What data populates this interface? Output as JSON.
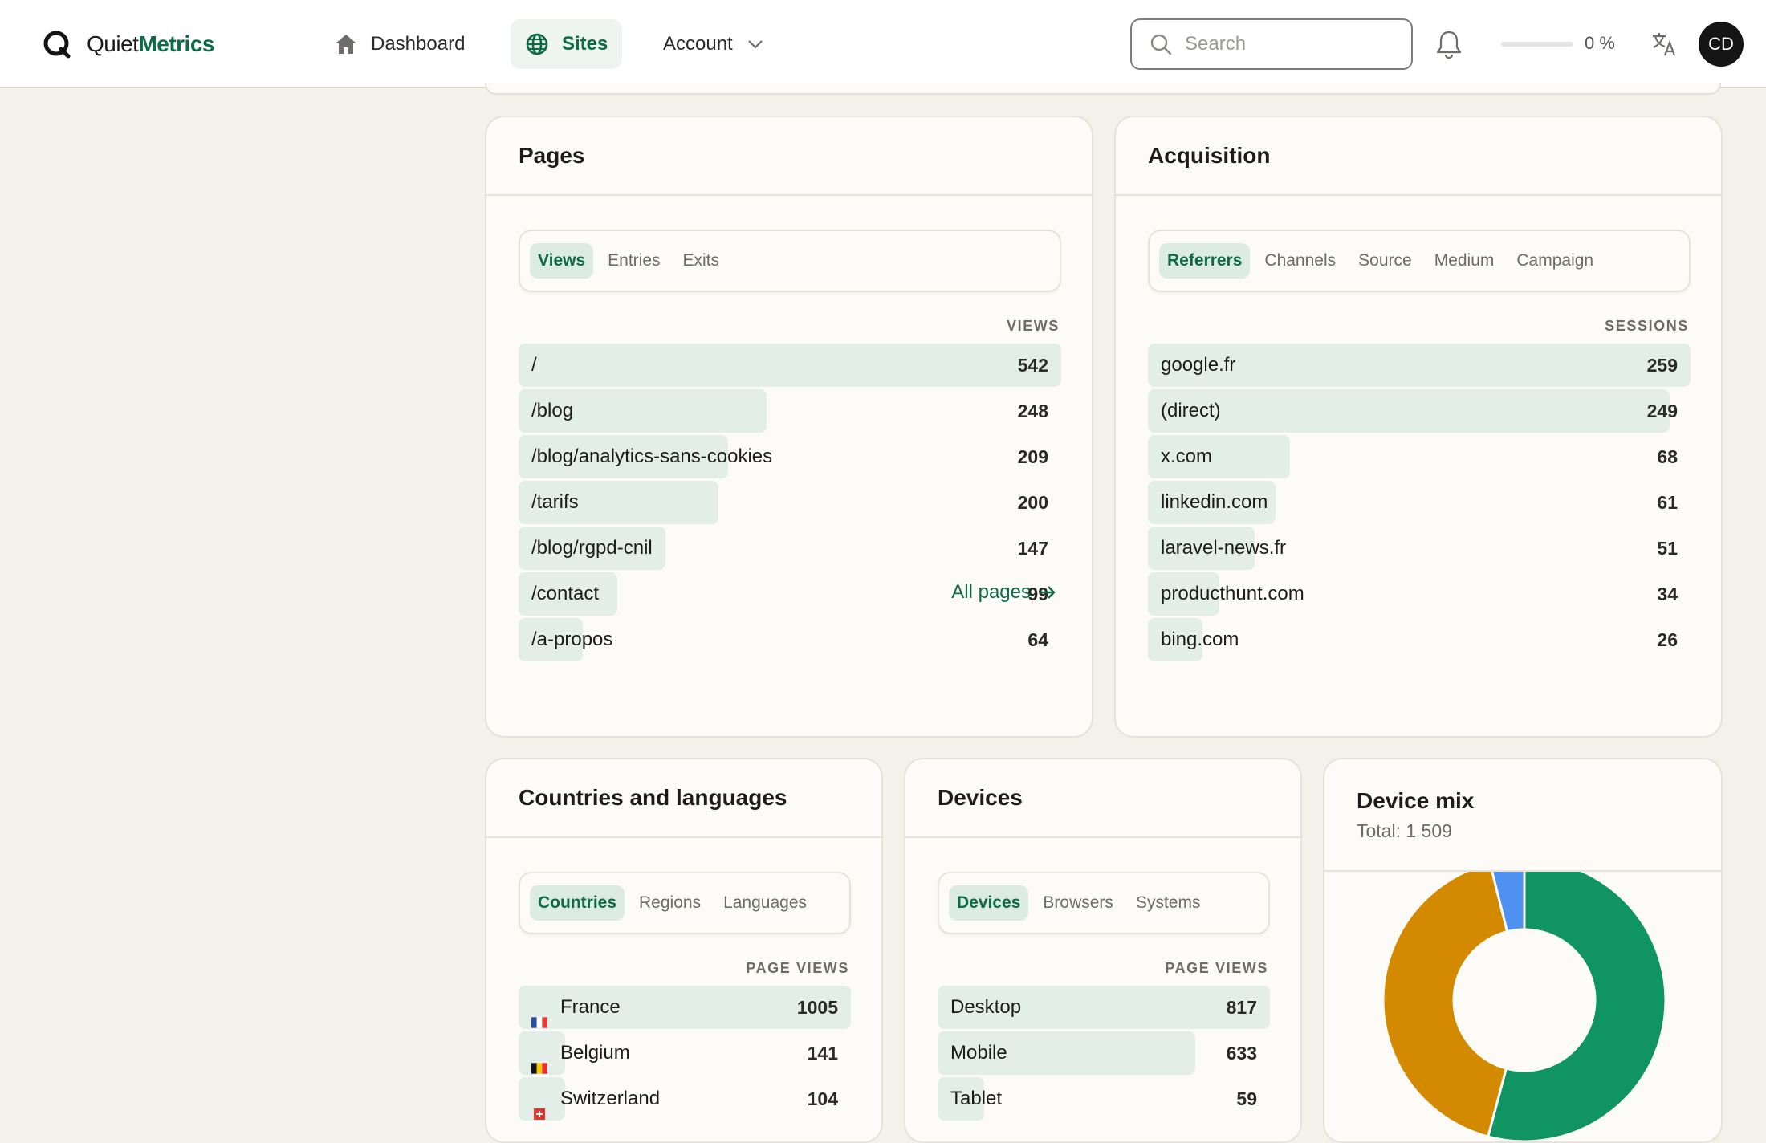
{
  "app": {
    "logo_prefix": "Quiet",
    "logo_suffix": "Metrics"
  },
  "nav": {
    "dashboard": "Dashboard",
    "sites": "Sites",
    "account": "Account"
  },
  "search": {
    "placeholder": "Search"
  },
  "progress": {
    "label": "0 %",
    "value": 0
  },
  "user": {
    "initials": "CD"
  },
  "colors": {
    "brand": "#0e6b47",
    "row_bar": "#e2eee7",
    "tab_active_bg": "#dcebe3",
    "desktop": "#119463",
    "mobile": "#d38a00",
    "tablet": "#4f91f0"
  },
  "pages": {
    "title": "Pages",
    "tabs": [
      "Views",
      "Entries",
      "Exits"
    ],
    "active_tab": 0,
    "column": "VIEWS",
    "max": 542,
    "rows": [
      {
        "label": "/",
        "value": 542
      },
      {
        "label": "/blog",
        "value": 248
      },
      {
        "label": "/blog/analytics-sans-cookies",
        "value": 209
      },
      {
        "label": "/tarifs",
        "value": 200
      },
      {
        "label": "/blog/rgpd-cnil",
        "value": 147
      },
      {
        "label": "/contact",
        "value": 99
      },
      {
        "label": "/a-propos",
        "value": 64
      }
    ],
    "all_link": "All pages"
  },
  "acquisition": {
    "title": "Acquisition",
    "tabs": [
      "Referrers",
      "Channels",
      "Source",
      "Medium",
      "Campaign"
    ],
    "active_tab": 0,
    "column": "SESSIONS",
    "max": 259,
    "rows": [
      {
        "label": "google.fr",
        "value": 259
      },
      {
        "label": "(direct)",
        "value": 249
      },
      {
        "label": "x.com",
        "value": 68
      },
      {
        "label": "linkedin.com",
        "value": 61
      },
      {
        "label": "laravel-news.fr",
        "value": 51
      },
      {
        "label": "producthunt.com",
        "value": 34
      },
      {
        "label": "bing.com",
        "value": 26
      }
    ]
  },
  "countries": {
    "title": "Countries and languages",
    "tabs": [
      "Countries",
      "Regions",
      "Languages"
    ],
    "active_tab": 0,
    "column": "PAGE VIEWS",
    "max": 1005,
    "rows": [
      {
        "label": "France",
        "value": 1005,
        "flag": "fr"
      },
      {
        "label": "Belgium",
        "value": 141,
        "flag": "be"
      },
      {
        "label": "Switzerland",
        "value": 104,
        "flag": "ch"
      }
    ]
  },
  "devices": {
    "title": "Devices",
    "tabs": [
      "Devices",
      "Browsers",
      "Systems"
    ],
    "active_tab": 0,
    "column": "PAGE VIEWS",
    "max": 817,
    "rows": [
      {
        "label": "Desktop",
        "value": 817
      },
      {
        "label": "Mobile",
        "value": 633
      },
      {
        "label": "Tablet",
        "value": 59
      }
    ]
  },
  "device_mix": {
    "title": "Device mix",
    "total_label": "Total: 1 509"
  },
  "chart_data": {
    "type": "pie",
    "donut": true,
    "categories": [
      "Desktop",
      "Mobile",
      "Tablet"
    ],
    "values": [
      817,
      633,
      59
    ],
    "colors": [
      "#119463",
      "#d38a00",
      "#4f91f0"
    ]
  }
}
